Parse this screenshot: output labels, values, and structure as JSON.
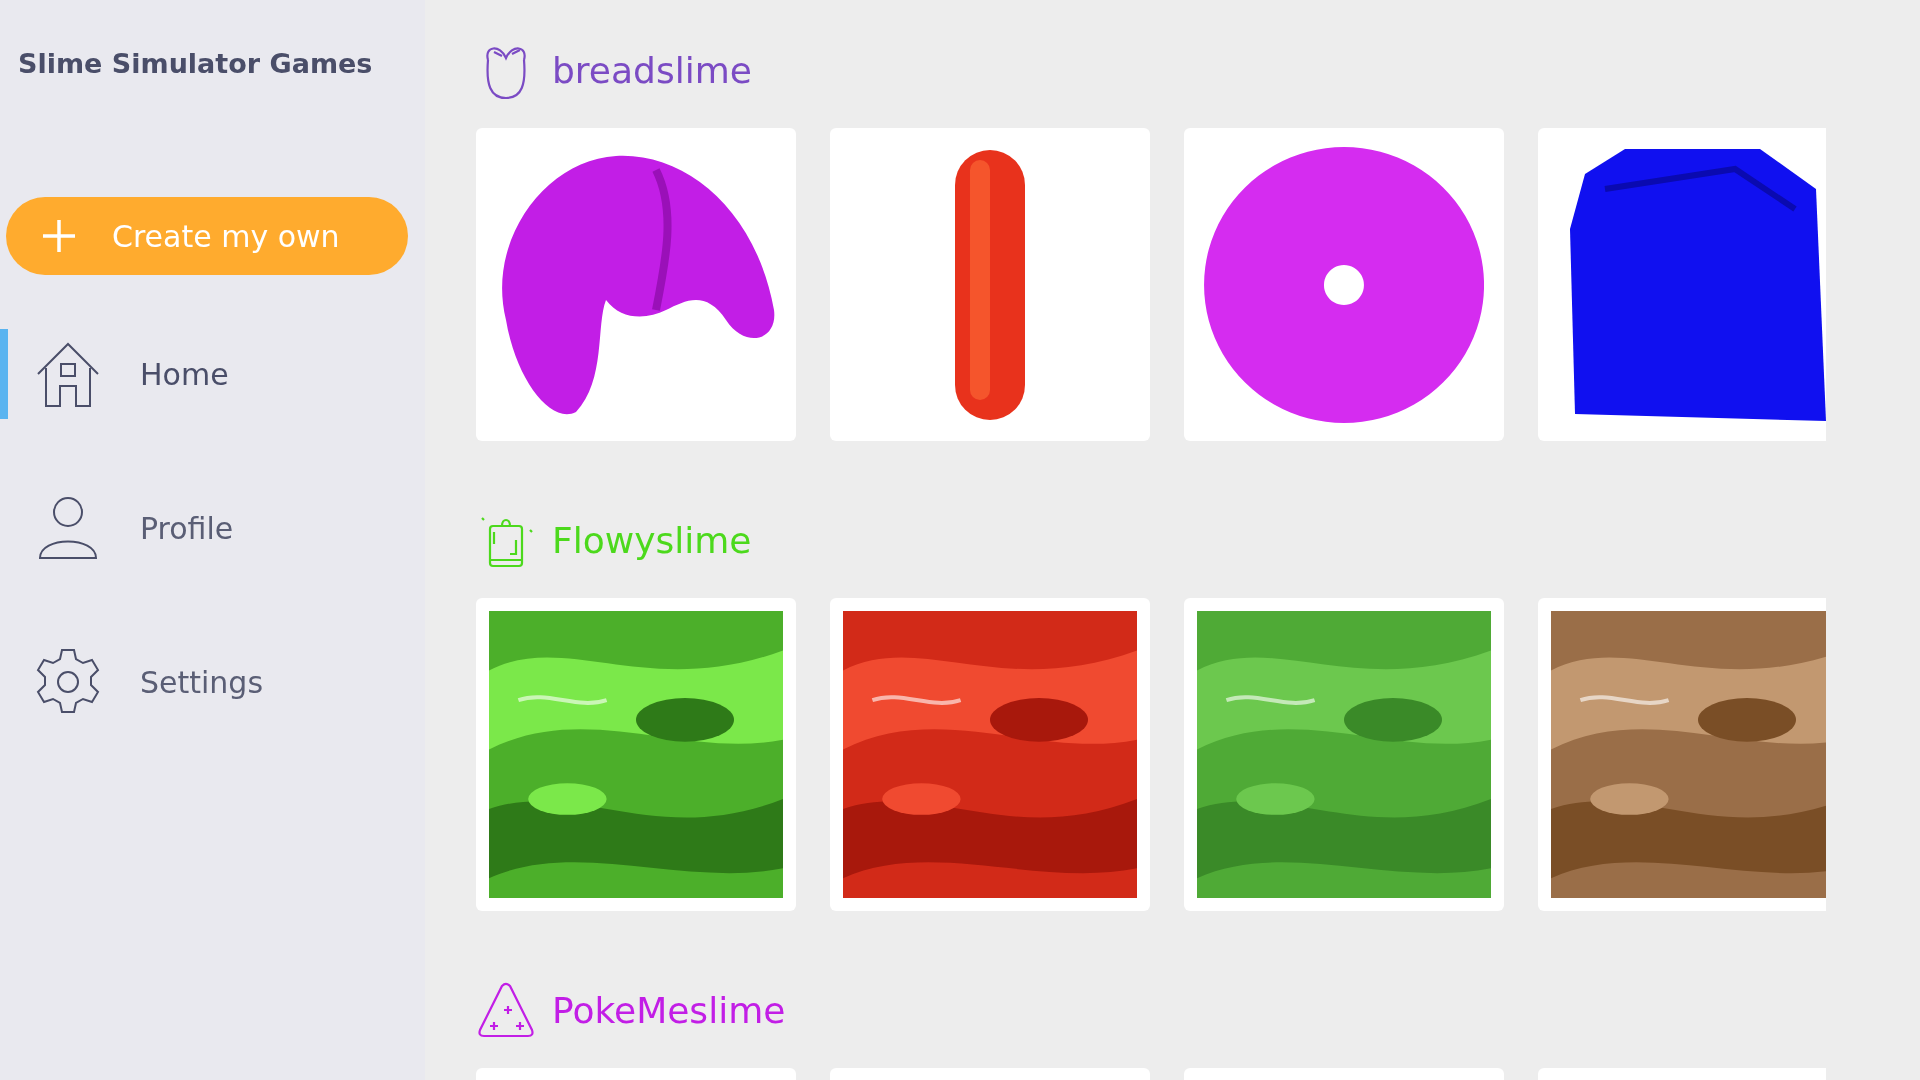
{
  "sidebar": {
    "title": "Slime Simulator Games",
    "create_button": {
      "label": "Create my own"
    },
    "items": [
      {
        "label": "Home",
        "selected": true
      },
      {
        "label": "Profile",
        "selected": false
      },
      {
        "label": "Settings",
        "selected": false
      }
    ]
  },
  "sections": [
    {
      "title": "breadslime",
      "color": "#7b4bc4"
    },
    {
      "title": "Flowyslime",
      "color": "#4cd91c"
    },
    {
      "title": "PokeMeslime",
      "color": "#c21ee6",
      "cards": [
        {
          "kind": "card"
        },
        {
          "kind": "card"
        },
        {
          "kind": "card"
        },
        {
          "kind": "card"
        }
      ]
    }
  ]
}
